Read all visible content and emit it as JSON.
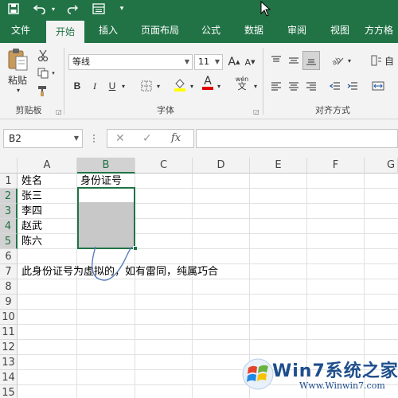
{
  "quick_access": {
    "icons": [
      "save-icon",
      "undo-icon",
      "undo-dropdown-icon",
      "redo-icon",
      "form-icon",
      "customize-dropdown-icon"
    ]
  },
  "tabs": [
    {
      "label": "文件",
      "active": false
    },
    {
      "label": "开始",
      "active": true
    },
    {
      "label": "插入",
      "active": false
    },
    {
      "label": "页面布局",
      "active": false
    },
    {
      "label": "公式",
      "active": false
    },
    {
      "label": "数据",
      "active": false
    },
    {
      "label": "审阅",
      "active": false
    },
    {
      "label": "视图",
      "active": false
    },
    {
      "label": "方方格",
      "active": false
    }
  ],
  "ribbon": {
    "clipboard": {
      "paste_label": "粘贴",
      "group_label": "剪贴板"
    },
    "font": {
      "font_name": "等线",
      "font_size": "11",
      "bold": "B",
      "italic": "I",
      "underline": "U",
      "grow": "A",
      "shrink": "A",
      "font_color_glyph": "A",
      "phonetic_glyph": "wén",
      "group_label": "字体"
    },
    "alignment": {
      "group_label": "对齐方式",
      "auto_label": "自"
    }
  },
  "formula_bar": {
    "name_box": "B2",
    "fx": "fx",
    "cancel": "✕",
    "enter": "✓",
    "value": ""
  },
  "grid": {
    "columns": [
      "A",
      "B",
      "C",
      "D",
      "E",
      "F",
      "G"
    ],
    "selected_column": "B",
    "rows": [
      "1",
      "2",
      "3",
      "4",
      "5",
      "6",
      "7",
      "8",
      "9",
      "10",
      "11",
      "12",
      "13",
      "14",
      "15"
    ],
    "selected_rows": [
      "2",
      "3",
      "4",
      "5"
    ],
    "cells": {
      "A1": "姓名",
      "B1": "身份证号",
      "A2": "张三",
      "A3": "李四",
      "A4": "赵武",
      "A5": "陈六",
      "A7": "此身份证号为虚拟的，如有雷同，纯属巧合"
    },
    "active_cell": "B2",
    "selection_range": "B2:B5"
  },
  "watermark": {
    "title": "Win7系统之家",
    "url": "Www.Winwin7.com"
  },
  "colors": {
    "accent": "#217346",
    "ribbon_bg": "#f3f3f3",
    "selection_fill": "#c8c8c8"
  }
}
